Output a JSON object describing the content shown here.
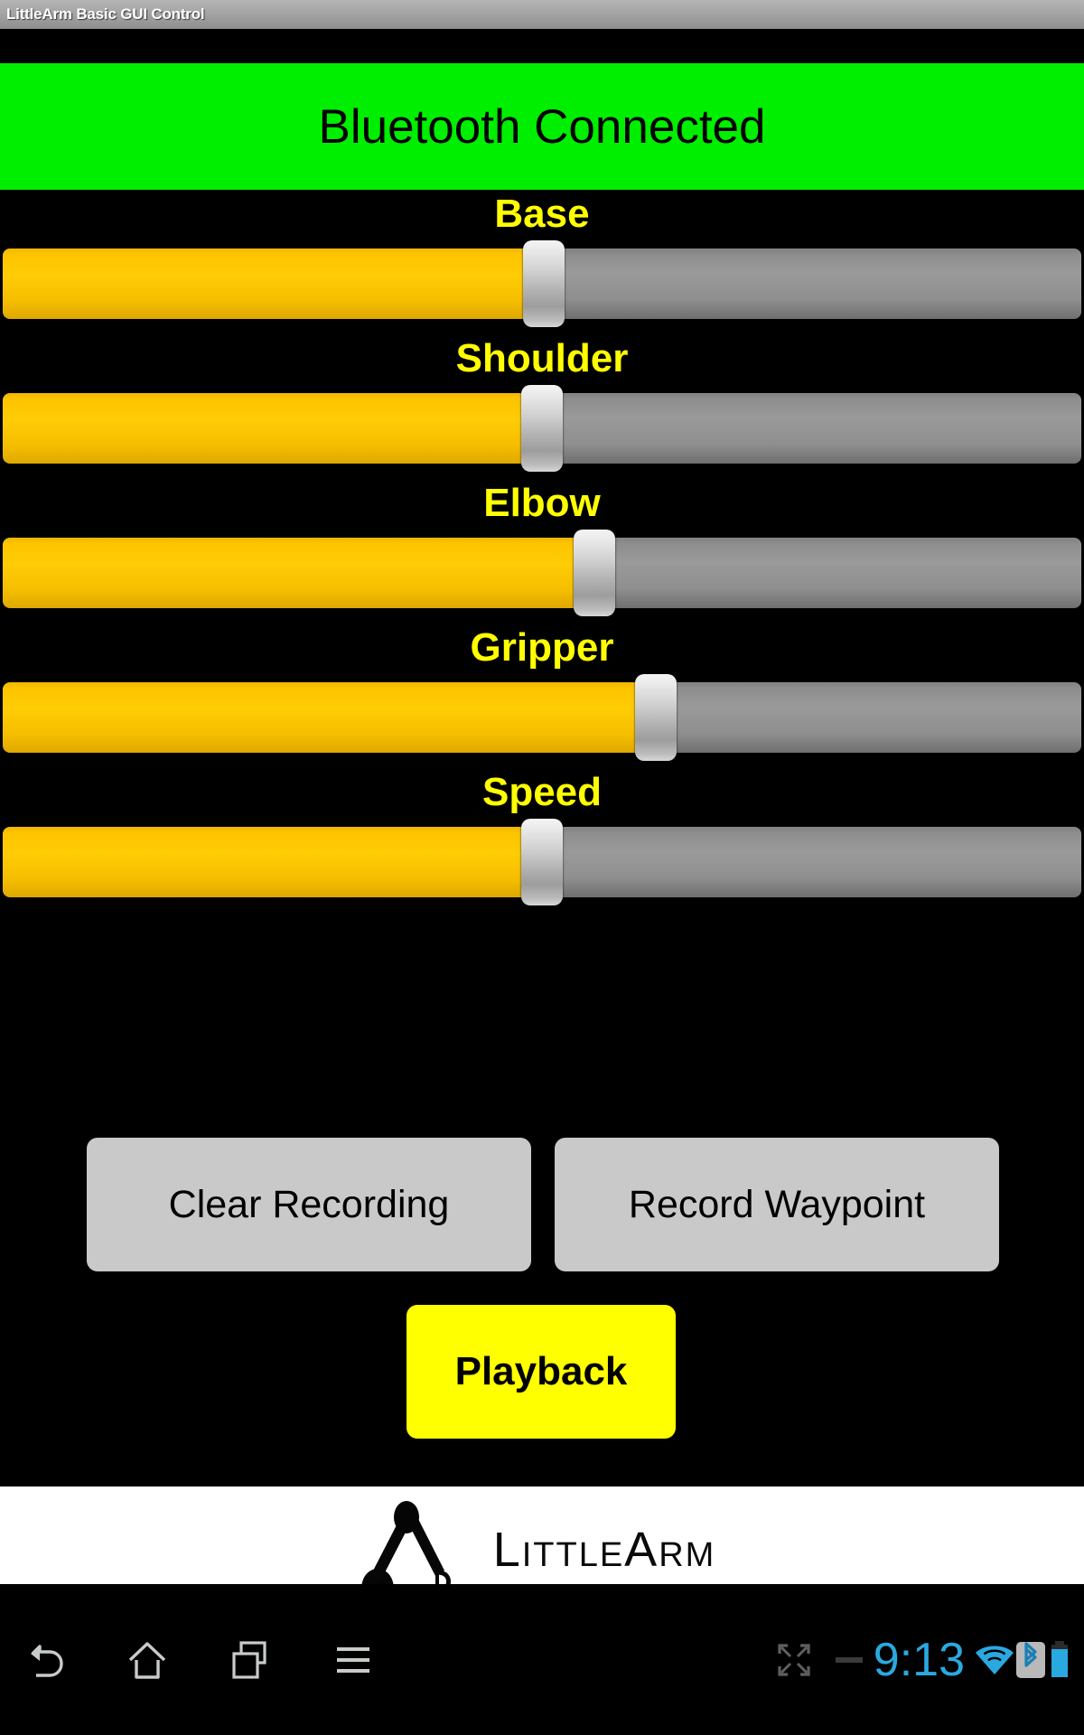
{
  "window": {
    "title": "LittleArm Basic GUI Control"
  },
  "status_banner": {
    "text": "Bluetooth Connected",
    "background_color": "#00ee00",
    "text_color": "#000000"
  },
  "theme": {
    "background_color": "#000000",
    "label_color": "#ffff00",
    "slider_fill_color": "#ffc800",
    "slider_track_color": "#909090",
    "button_color": "#c9c9c9",
    "accent_button_color": "#ffff00",
    "status_accent_color": "#2aa9e0"
  },
  "sliders": [
    {
      "label": "Base",
      "value_percent": 50.2,
      "fill_percent": 48.5,
      "thumb_percent": 50.2
    },
    {
      "label": "Shoulder",
      "value_percent": 50.0,
      "fill_percent": 48.3,
      "thumb_percent": 50.0
    },
    {
      "label": "Elbow",
      "value_percent": 54.8,
      "fill_percent": 53.1,
      "thumb_percent": 54.8
    },
    {
      "label": "Gripper",
      "value_percent": 60.5,
      "fill_percent": 58.8,
      "thumb_percent": 60.5
    },
    {
      "label": "Speed",
      "value_percent": 50.0,
      "fill_percent": 48.3,
      "thumb_percent": 50.0
    }
  ],
  "buttons": {
    "clear_recording": "Clear Recording",
    "record_waypoint": "Record Waypoint",
    "playback": "Playback"
  },
  "branding": {
    "logo_text": "LittleArm",
    "logo_icon": "robot-arm-icon"
  },
  "navbar": {
    "back": "back-icon",
    "home": "home-icon",
    "recents": "recents-icon",
    "menu": "menu-icon"
  },
  "system_status": {
    "fullscreen_icon": "fullscreen-icon",
    "separator": "dash-separator",
    "clock": "9:13",
    "wifi_icon": "wifi-icon",
    "bluetooth_icon": "bluetooth-icon",
    "battery_icon": "battery-icon"
  }
}
